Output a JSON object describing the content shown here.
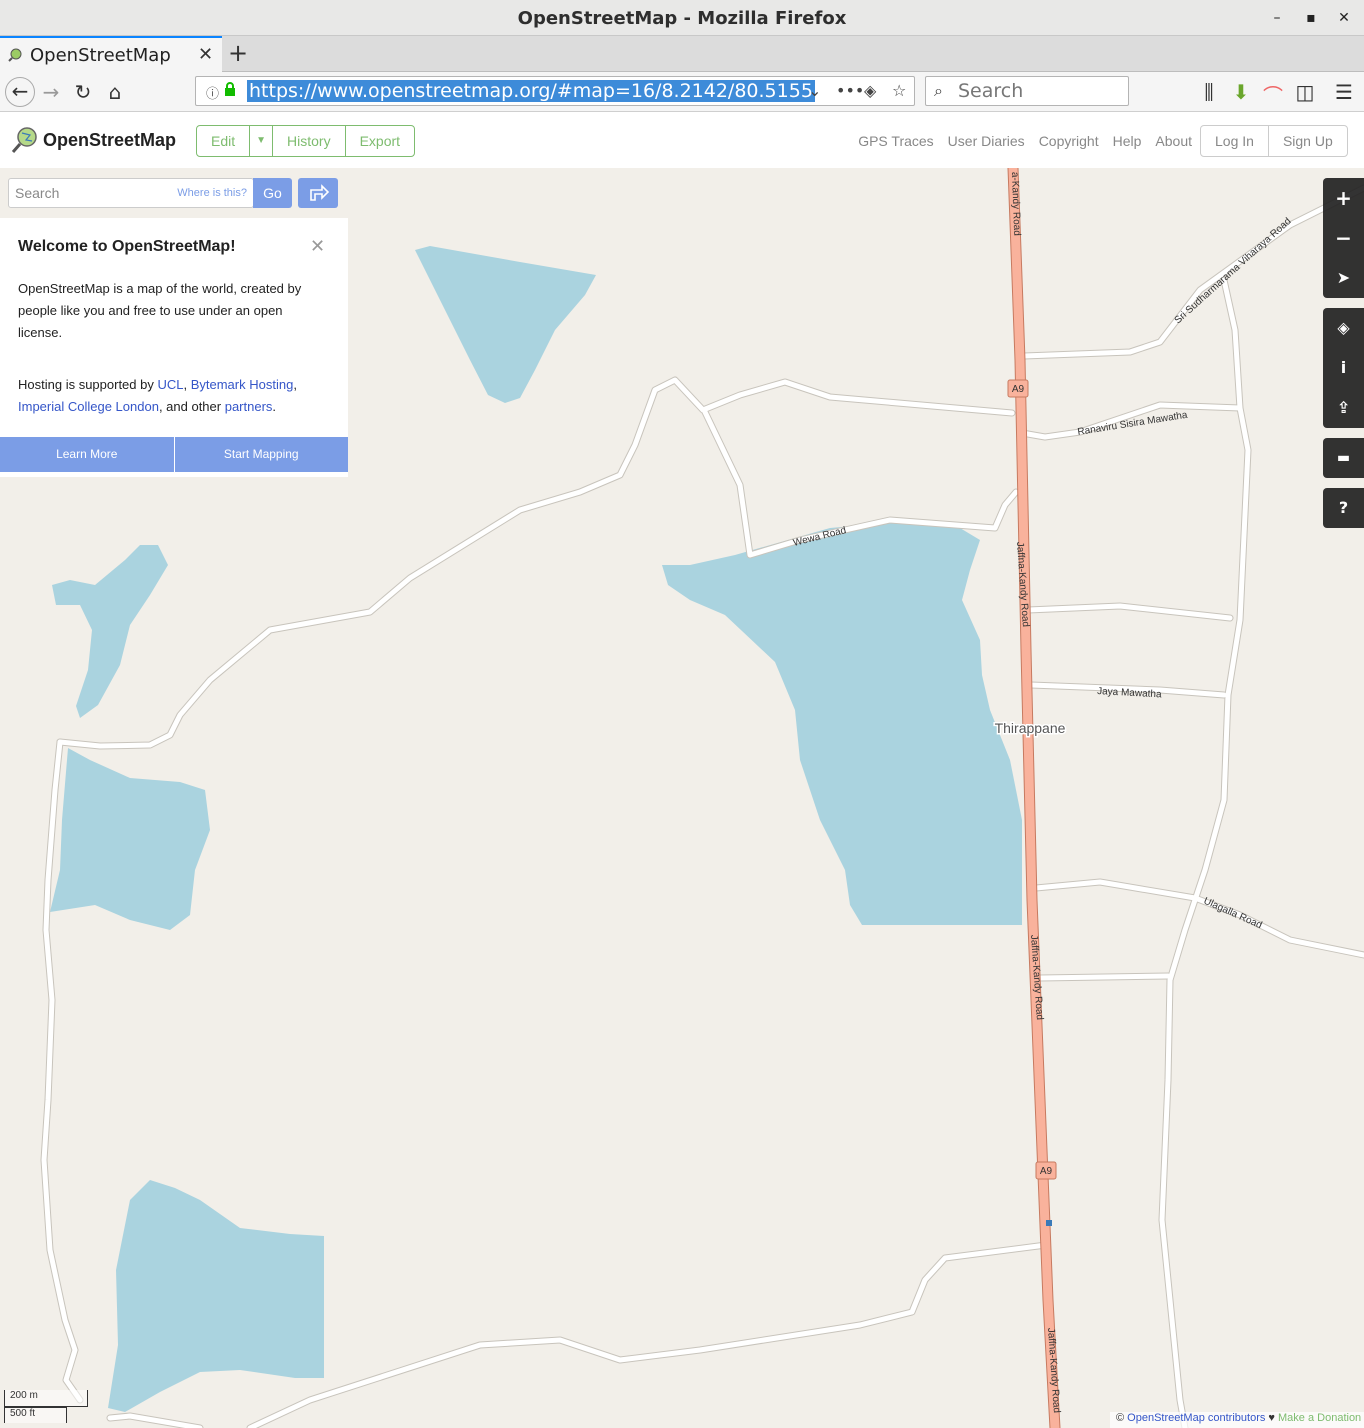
{
  "window": {
    "title": "OpenStreetMap - Mozilla Firefox"
  },
  "tabs": [
    {
      "label": "OpenStreetMap"
    }
  ],
  "browser": {
    "url": "https://www.openstreetmap.org/#map=16/8.2142/80.5155",
    "search_placeholder": "Search"
  },
  "osm": {
    "brand": "OpenStreetMap",
    "edit_buttons": [
      "Edit",
      "History",
      "Export"
    ],
    "nav_links": [
      "GPS Traces",
      "User Diaries",
      "Copyright",
      "Help",
      "About"
    ],
    "auth": [
      "Log In",
      "Sign Up"
    ]
  },
  "sidebar": {
    "search_placeholder": "Search",
    "where_is_this": "Where is this?",
    "go": "Go",
    "welcome": {
      "title": "Welcome to OpenStreetMap!",
      "intro": "OpenStreetMap is a map of the world, created by people like you and free to use under an open license.",
      "hosting_prefix": "Hosting is supported by ",
      "host1": "UCL",
      "host2": "Bytemark Hosting",
      "host3": "Imperial College London",
      "hosting_mid": ", and other ",
      "partners": "partners",
      "learn_more": "Learn More",
      "start_mapping": "Start Mapping"
    }
  },
  "map": {
    "place_label": "Thirappane",
    "route_shield": "A9",
    "roads": {
      "jaffna_kandy": "Jaffna-Kandy Road",
      "jaffna_kandy_partial": "a-Kandy Road",
      "wewa": "Wewa Road",
      "ranaviru": "Ranaviru Sisira Mawatha",
      "jaya": "Jaya Mawatha",
      "ulagalla": "Ulagalla Road",
      "sri": "Sri Sudharmarama Viharaya Road"
    },
    "scale_metric": "200 m",
    "scale_imperial": "500 ft",
    "attribution_prefix": "© ",
    "attribution_link": "OpenStreetMap contributors",
    "attribution_heart": " ♥ ",
    "donate": "Make a Donation"
  },
  "colors": {
    "water": "#aad3df",
    "land": "#f2efe9",
    "trunk": "#f9b29c",
    "accent": "#7ebc6f",
    "button": "#7b9de6"
  }
}
